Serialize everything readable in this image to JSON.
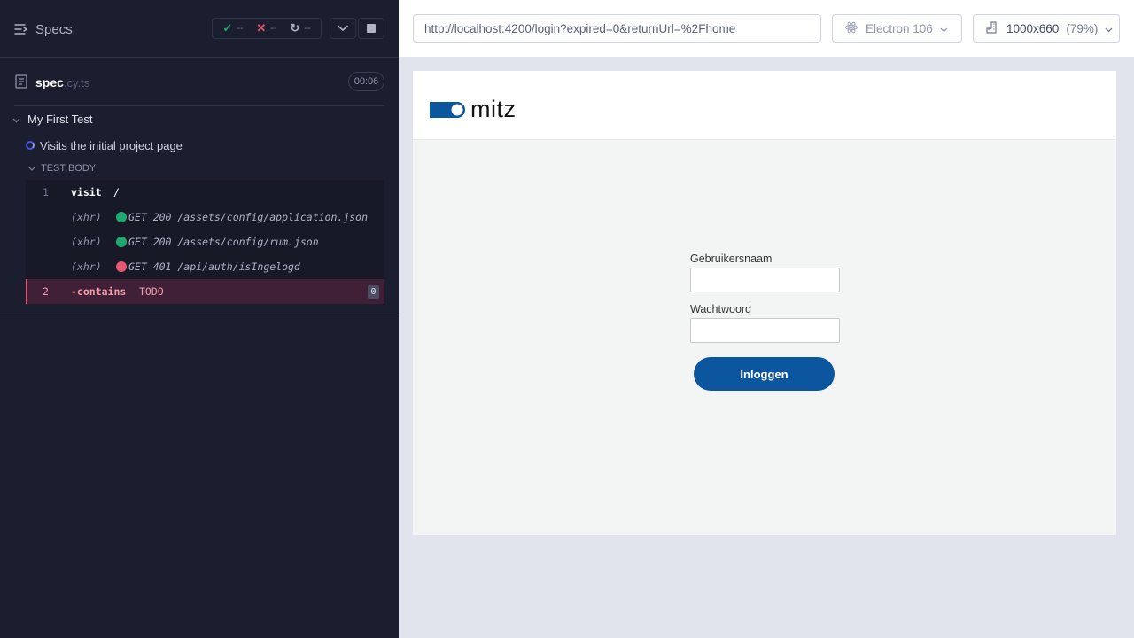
{
  "reporter": {
    "specs_label": "Specs",
    "stats": {
      "passed": "--",
      "failed": "--",
      "pending": "--"
    },
    "spec_name": "spec",
    "spec_ext": ".cy.ts",
    "duration": "00:06",
    "suite_title": "My First Test",
    "test_title": "Visits the initial project page",
    "test_body_label": "TEST BODY",
    "commands": [
      {
        "number": "1",
        "name": "visit",
        "message": "/"
      },
      {
        "kind": "(xhr)",
        "status_color": "#1fa971",
        "message": "GET 200 /assets/config/application.json"
      },
      {
        "kind": "(xhr)",
        "status_color": "#1fa971",
        "message": "GET 200 /assets/config/rum.json"
      },
      {
        "kind": "(xhr)",
        "status_color": "#e45770",
        "message": "GET 401 /api/auth/isIngelogd"
      },
      {
        "number": "2",
        "name": "-contains",
        "message": "TODO",
        "badge": "0"
      }
    ]
  },
  "aut": {
    "url": "http://localhost:4200/login?expired=0&returnUrl=%2Fhome",
    "browser": "Electron 106",
    "viewport_size": "1000x660",
    "viewport_scale": "(79%)",
    "app": {
      "logo_text": "mitz",
      "username_label": "Gebruikersnaam",
      "password_label": "Wachtwoord",
      "username_value": "",
      "password_value": "",
      "login_button": "Inloggen"
    }
  },
  "colors": {
    "reporter_bg": "#1b1e2e",
    "pass": "#1fa971",
    "fail": "#e45770",
    "brand_blue": "#0c56a0"
  }
}
